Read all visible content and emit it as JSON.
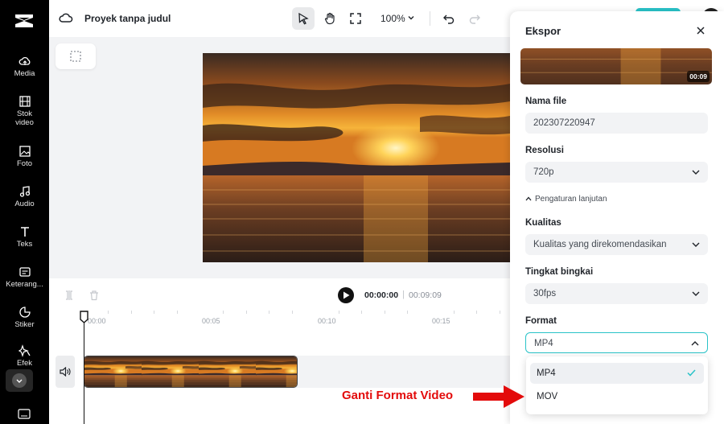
{
  "app": {
    "project_title": "Proyek tanpa judul",
    "zoom_level": "100%",
    "accent_color": "#29c3c8"
  },
  "sidebar": {
    "items": [
      {
        "label": "Media",
        "icon": "cloud-upload-icon"
      },
      {
        "label": "Stok video",
        "icon": "film-icon"
      },
      {
        "label": "Foto",
        "icon": "image-icon"
      },
      {
        "label": "Audio",
        "icon": "music-note-icon"
      },
      {
        "label": "Teks",
        "icon": "text-icon"
      },
      {
        "label": "Keterang...",
        "icon": "caption-icon"
      },
      {
        "label": "Stiker",
        "icon": "sticker-icon"
      },
      {
        "label": "Efek",
        "icon": "sparkle-icon"
      }
    ]
  },
  "timeline": {
    "current_time": "00:00:00",
    "separator": "|",
    "total_time": "00:09:09",
    "ticks": [
      "00:00",
      "00:05",
      "00:10",
      "00:15"
    ]
  },
  "export_panel": {
    "title": "Ekspor",
    "thumbnail_duration": "00:09",
    "file_name_label": "Nama file",
    "file_name_value": "202307220947",
    "resolution_label": "Resolusi",
    "resolution_value": "720p",
    "advanced_label": "Pengaturan lanjutan",
    "quality_label": "Kualitas",
    "quality_value": "Kualitas yang direkomendasikan",
    "framerate_label": "Tingkat bingkai",
    "framerate_value": "30fps",
    "format_label": "Format",
    "format_value": "MP4",
    "format_options": [
      "MP4",
      "MOV"
    ]
  },
  "annotation": {
    "text": "Ganti Format Video",
    "color": "#e30b0b"
  }
}
